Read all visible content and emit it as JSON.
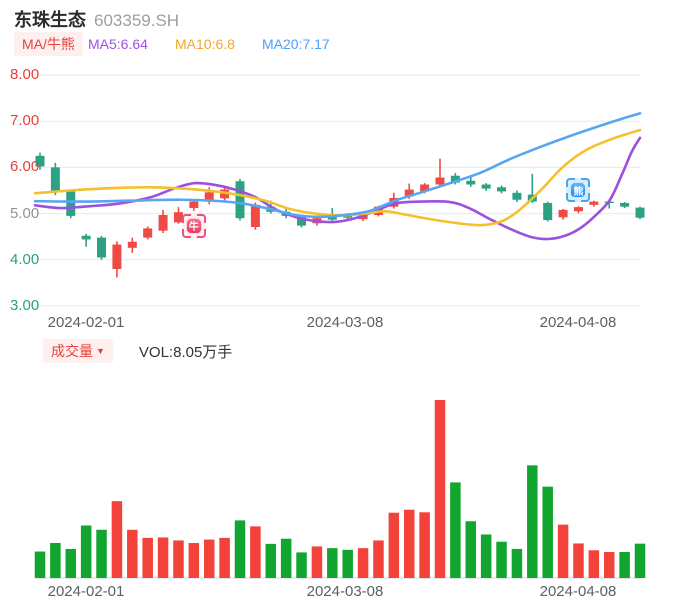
{
  "header": {
    "title": "东珠生态",
    "code": "603359.SH",
    "ma_chip": "MA/牛熊",
    "ma5_label": "MA5:6.64",
    "ma10_label": "MA10:6.8",
    "ma20_label": "MA20:7.17"
  },
  "volume_header": {
    "chip": "成交量",
    "chip_arrow": "▼",
    "vol_label": "VOL:8.05万手"
  },
  "badges": {
    "bull": "牛",
    "bear": "熊"
  },
  "colors": {
    "candle_up": "#ef4a43",
    "candle_down": "#2da183",
    "vol_up": "#f3423a",
    "vol_down": "#12a630",
    "ma5": "#9b51e0",
    "ma10": "#f5c02c",
    "ma20": "#58a6f2",
    "grid": "#e7eaf0",
    "axis_line": "#dfe2e8",
    "tick_red": "#e8403f",
    "tick_green": "#2aa36f",
    "tick_gray": "#8e939c",
    "date_label": "#5c6066"
  },
  "chart_data": {
    "type": "candlestick+volume",
    "title": "东珠生态 603359.SH",
    "ylim": [
      3,
      8
    ],
    "grid": true,
    "price_axis_ticks": [
      {
        "label": "8.00",
        "price": 8,
        "color": "#e8403f"
      },
      {
        "label": "7.00",
        "price": 7,
        "color": "#e8403f"
      },
      {
        "label": "6.00",
        "price": 6,
        "color": "#e8403f"
      },
      {
        "label": "5.00",
        "price": 5,
        "color": "#8e939c"
      },
      {
        "label": "4.00",
        "price": 4,
        "color": "#2aa36f"
      },
      {
        "label": "3.00",
        "price": 3,
        "color": "#2aa36f"
      }
    ],
    "x_labels": [
      {
        "text": "2024-02-01",
        "x": 86
      },
      {
        "text": "2024-03-08",
        "x": 345
      },
      {
        "text": "2024-04-08",
        "x": 578
      }
    ],
    "series": [
      {
        "name": "MA5",
        "value": 6.64,
        "color_key": "ma5",
        "points": [
          [
            35,
            5.18
          ],
          [
            60,
            5.12
          ],
          [
            90,
            5.16
          ],
          [
            120,
            5.22
          ],
          [
            150,
            5.35
          ],
          [
            175,
            5.55
          ],
          [
            195,
            5.66
          ],
          [
            215,
            5.62
          ],
          [
            235,
            5.52
          ],
          [
            255,
            5.36
          ],
          [
            275,
            5.1
          ],
          [
            295,
            4.93
          ],
          [
            315,
            4.84
          ],
          [
            335,
            4.82
          ],
          [
            355,
            4.9
          ],
          [
            375,
            5.05
          ],
          [
            395,
            5.22
          ],
          [
            420,
            5.26
          ],
          [
            450,
            5.25
          ],
          [
            470,
            5.11
          ],
          [
            490,
            4.88
          ],
          [
            510,
            4.67
          ],
          [
            530,
            4.5
          ],
          [
            548,
            4.45
          ],
          [
            565,
            4.52
          ],
          [
            580,
            4.68
          ],
          [
            595,
            4.95
          ],
          [
            610,
            5.3
          ],
          [
            622,
            5.85
          ],
          [
            632,
            6.35
          ],
          [
            640,
            6.64
          ]
        ]
      },
      {
        "name": "MA10",
        "value": 6.8,
        "color_key": "ma10",
        "points": [
          [
            35,
            5.44
          ],
          [
            70,
            5.5
          ],
          [
            110,
            5.55
          ],
          [
            150,
            5.57
          ],
          [
            185,
            5.54
          ],
          [
            215,
            5.48
          ],
          [
            240,
            5.4
          ],
          [
            265,
            5.28
          ],
          [
            290,
            5.1
          ],
          [
            315,
            5.0
          ],
          [
            340,
            4.96
          ],
          [
            365,
            5.0
          ],
          [
            385,
            5.05
          ],
          [
            405,
            4.98
          ],
          [
            430,
            4.88
          ],
          [
            455,
            4.8
          ],
          [
            480,
            4.75
          ],
          [
            500,
            4.82
          ],
          [
            515,
            5.0
          ],
          [
            530,
            5.28
          ],
          [
            545,
            5.6
          ],
          [
            560,
            5.95
          ],
          [
            575,
            6.22
          ],
          [
            590,
            6.42
          ],
          [
            610,
            6.6
          ],
          [
            625,
            6.71
          ],
          [
            640,
            6.81
          ]
        ]
      },
      {
        "name": "MA20",
        "value": 7.17,
        "color_key": "ma20",
        "points": [
          [
            35,
            5.27
          ],
          [
            80,
            5.26
          ],
          [
            130,
            5.28
          ],
          [
            180,
            5.3
          ],
          [
            220,
            5.27
          ],
          [
            245,
            5.21
          ],
          [
            270,
            5.1
          ],
          [
            295,
            4.97
          ],
          [
            320,
            4.93
          ],
          [
            345,
            4.97
          ],
          [
            370,
            5.06
          ],
          [
            395,
            5.28
          ],
          [
            420,
            5.45
          ],
          [
            450,
            5.66
          ],
          [
            480,
            5.88
          ],
          [
            510,
            6.18
          ],
          [
            540,
            6.44
          ],
          [
            570,
            6.68
          ],
          [
            600,
            6.9
          ],
          [
            620,
            7.04
          ],
          [
            640,
            7.17
          ]
        ]
      }
    ],
    "candles": [
      [
        6.25,
        6.32,
        5.95,
        6.02
      ],
      [
        6.0,
        6.1,
        5.4,
        5.46
      ],
      [
        5.48,
        5.52,
        4.9,
        4.95
      ],
      [
        4.52,
        4.56,
        4.28,
        4.44
      ],
      [
        4.48,
        4.52,
        4.0,
        4.05
      ],
      [
        3.8,
        4.4,
        3.62,
        4.33
      ],
      [
        4.26,
        4.48,
        4.15,
        4.39
      ],
      [
        4.48,
        4.72,
        4.44,
        4.68
      ],
      [
        4.63,
        5.08,
        4.58,
        4.97
      ],
      [
        4.81,
        5.14,
        4.78,
        5.03
      ],
      [
        5.12,
        5.3,
        5.06,
        5.26
      ],
      [
        5.26,
        5.57,
        5.2,
        5.46
      ],
      [
        5.33,
        5.58,
        5.28,
        5.52
      ],
      [
        5.7,
        5.75,
        4.85,
        4.9
      ],
      [
        4.71,
        5.24,
        4.65,
        5.19
      ],
      [
        5.15,
        5.28,
        5.0,
        5.04
      ],
      [
        5.04,
        5.1,
        4.9,
        4.95
      ],
      [
        4.93,
        4.96,
        4.7,
        4.74
      ],
      [
        4.79,
        4.93,
        4.74,
        4.9
      ],
      [
        4.97,
        5.12,
        4.84,
        4.87
      ],
      [
        4.98,
        5.01,
        4.86,
        4.91
      ],
      [
        4.88,
        4.99,
        4.84,
        4.97
      ],
      [
        4.97,
        5.17,
        4.94,
        5.15
      ],
      [
        5.15,
        5.45,
        5.11,
        5.34
      ],
      [
        5.37,
        5.65,
        5.32,
        5.52
      ],
      [
        5.48,
        5.66,
        5.44,
        5.63
      ],
      [
        5.63,
        6.19,
        5.58,
        5.78
      ],
      [
        5.82,
        5.88,
        5.63,
        5.67
      ],
      [
        5.71,
        5.79,
        5.58,
        5.63
      ],
      [
        5.63,
        5.66,
        5.49,
        5.54
      ],
      [
        5.57,
        5.61,
        5.44,
        5.48
      ],
      [
        5.45,
        5.5,
        5.25,
        5.3
      ],
      [
        5.41,
        5.86,
        5.23,
        5.26
      ],
      [
        5.23,
        5.26,
        4.83,
        4.86
      ],
      [
        4.92,
        5.1,
        4.87,
        5.08
      ],
      [
        5.05,
        5.16,
        5.01,
        5.14
      ],
      [
        5.19,
        5.28,
        5.15,
        5.26
      ],
      [
        5.26,
        5.28,
        5.11,
        5.25
      ],
      [
        5.23,
        5.25,
        5.12,
        5.15
      ],
      [
        5.13,
        5.15,
        4.88,
        4.91
      ]
    ],
    "volumes_wan_shou": [
      6.2,
      8.2,
      6.8,
      12.3,
      11.3,
      18.0,
      11.3,
      9.4,
      9.5,
      8.8,
      8.2,
      9.0,
      9.4,
      13.5,
      12.1,
      8.0,
      9.2,
      6.0,
      7.4,
      7.0,
      6.6,
      7.0,
      8.8,
      15.3,
      16.0,
      15.4,
      41.7,
      22.4,
      13.3,
      10.2,
      8.5,
      6.8,
      26.4,
      21.4,
      12.5,
      8.1,
      6.5,
      6.1,
      6.1,
      8.05
    ],
    "volume_colors": [
      "g",
      "g",
      "g",
      "g",
      "g",
      "r",
      "r",
      "r",
      "r",
      "r",
      "r",
      "r",
      "r",
      "g",
      "r",
      "g",
      "g",
      "g",
      "r",
      "g",
      "g",
      "r",
      "r",
      "r",
      "r",
      "r",
      "r",
      "g",
      "g",
      "g",
      "g",
      "g",
      "g",
      "g",
      "r",
      "r",
      "r",
      "r",
      "g",
      "g"
    ],
    "markers": {
      "bull": {
        "candle_index": 10,
        "position": "below"
      },
      "bear": {
        "candle_index": 35,
        "position": "above"
      }
    },
    "legend_position": "top"
  }
}
